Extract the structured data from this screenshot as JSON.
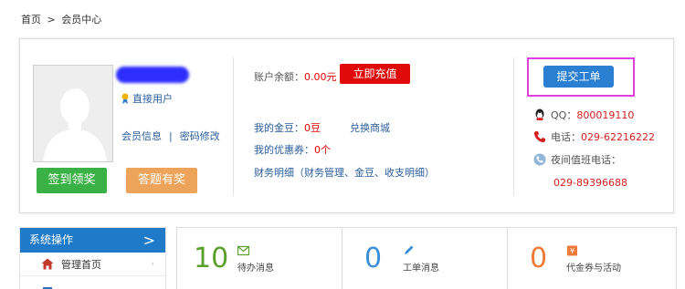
{
  "breadcrumb": {
    "home": "首页",
    "separator": ">",
    "current": "会员中心"
  },
  "profile": {
    "member_type": "直接用户",
    "links": {
      "info": "会员信息",
      "separator": "|",
      "password": "密码修改"
    },
    "buttons": {
      "sign_in": "签到领奖",
      "answer": "答题有奖"
    }
  },
  "account": {
    "balance_label": "账户余额：",
    "balance_value": "0.00元",
    "recharge_label": "立即充值",
    "beans_label": "我的金豆：",
    "beans_value": "0豆",
    "exchange_label": "兑换商城",
    "coupons_label": "我的优惠券：",
    "coupons_value": "0个",
    "finance_label": "财务明细（财务管理、金豆、收支明细）"
  },
  "support": {
    "ticket_label": "提交工单",
    "qq_label": "QQ：",
    "qq_value": "800019110",
    "phone_label": "电话：",
    "phone_value": "029-62216222",
    "night_label": "夜间值班电话：",
    "night_value": "029-89396688"
  },
  "sidebar": {
    "title": "系统操作",
    "chevron": ">",
    "items": [
      {
        "label": "管理首页",
        "arrow": "›"
      }
    ]
  },
  "stats": [
    {
      "value": "10",
      "label": "待办消息",
      "color": "#5aa02c",
      "icon": "envelope-icon"
    },
    {
      "value": "0",
      "label": "工单消息",
      "color": "#3a8fd6",
      "icon": "pencil-icon"
    },
    {
      "value": "0",
      "label": "代金券与活动",
      "color": "#f07a3a",
      "icon": "coupon-icon"
    }
  ],
  "colors": {
    "accent_blue": "#2b7fd2",
    "red": "#e00a0a",
    "green": "#3ab145",
    "orange": "#eda35a",
    "highlight": "#e040e0"
  }
}
